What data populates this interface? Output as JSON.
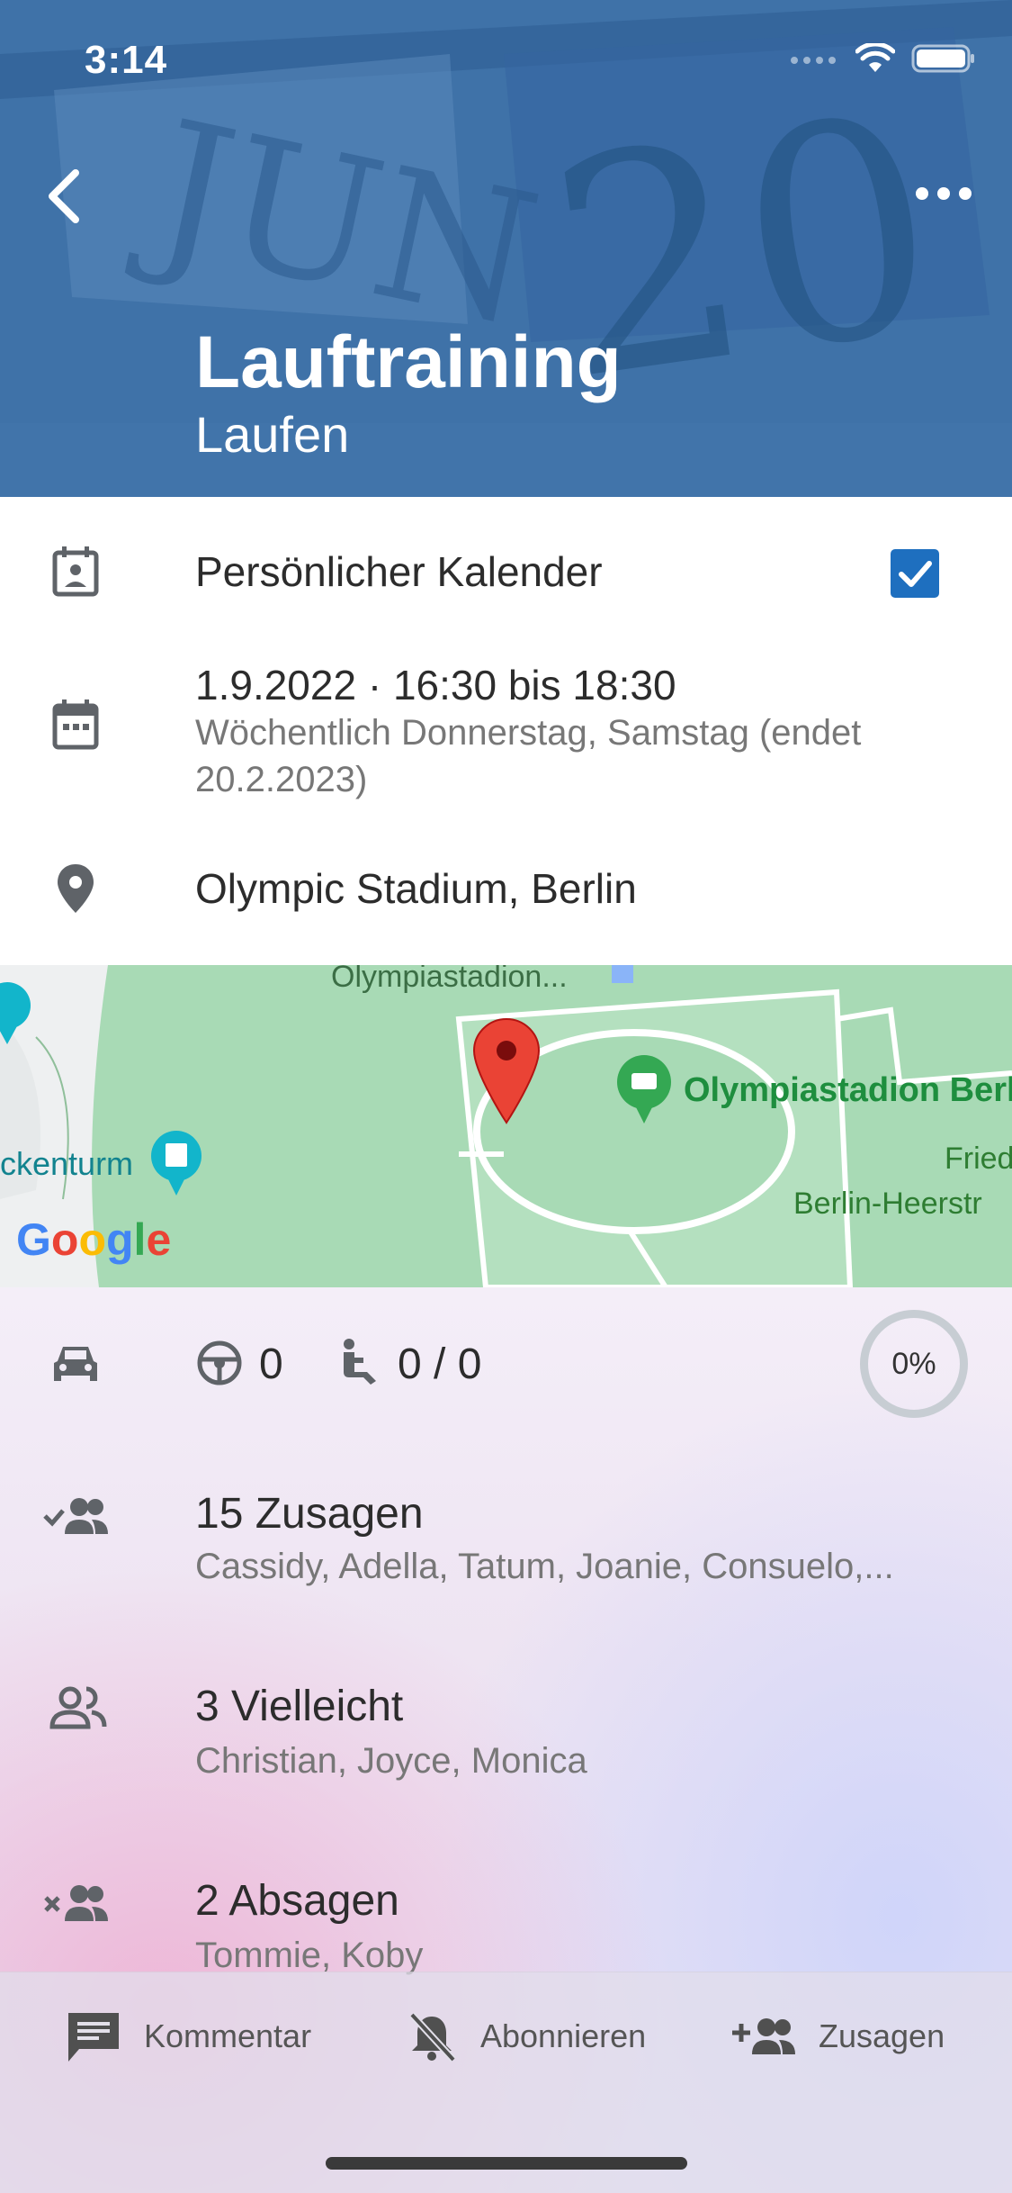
{
  "status_bar": {
    "time": "3:14"
  },
  "header": {
    "title": "Lauftraining",
    "subtitle": "Laufen"
  },
  "calendar": {
    "label": "Persönlicher Kalender",
    "checked": true
  },
  "datetime": {
    "main": "1.9.2022 · 16:30 bis 18:30",
    "recurrence_line1": "Wöchentlich Donnerstag, Samstag (endet",
    "recurrence_line2": "20.2.2023)"
  },
  "location": {
    "name": "Olympic Stadium, Berlin"
  },
  "map": {
    "labels": {
      "top": "Olympiastadion...",
      "stadium": "Olympiastadion Berl",
      "tower": "ckenturm",
      "right1": "Fried",
      "right2": "Berlin-Heerstr"
    },
    "google": [
      "G",
      "o",
      "o",
      "g",
      "l",
      "e"
    ],
    "google_colors": [
      "#4285F4",
      "#EA4335",
      "#FBBC05",
      "#4285F4",
      "#34A853",
      "#EA4335"
    ]
  },
  "transport": {
    "drivers": "0",
    "seats": "0 / 0",
    "progress": "0%"
  },
  "attendance": {
    "accepted": {
      "title": "15 Zusagen",
      "names": "Cassidy, Adella, Tatum, Joanie, Consuelo,..."
    },
    "maybe": {
      "title": "3 Vielleicht",
      "names": "Christian, Joyce, Monica"
    },
    "declined": {
      "title": "2 Absagen",
      "names": "Tommie, Koby"
    }
  },
  "bottom_bar": {
    "comment": "Kommentar",
    "subscribe": "Abonnieren",
    "accept": "Zusagen"
  },
  "colors": {
    "header": "#4478ae",
    "checkbox": "#1e6fbf",
    "icon": "#5f6368",
    "map_green": "#a8dab5",
    "marker": "#ea4335"
  }
}
